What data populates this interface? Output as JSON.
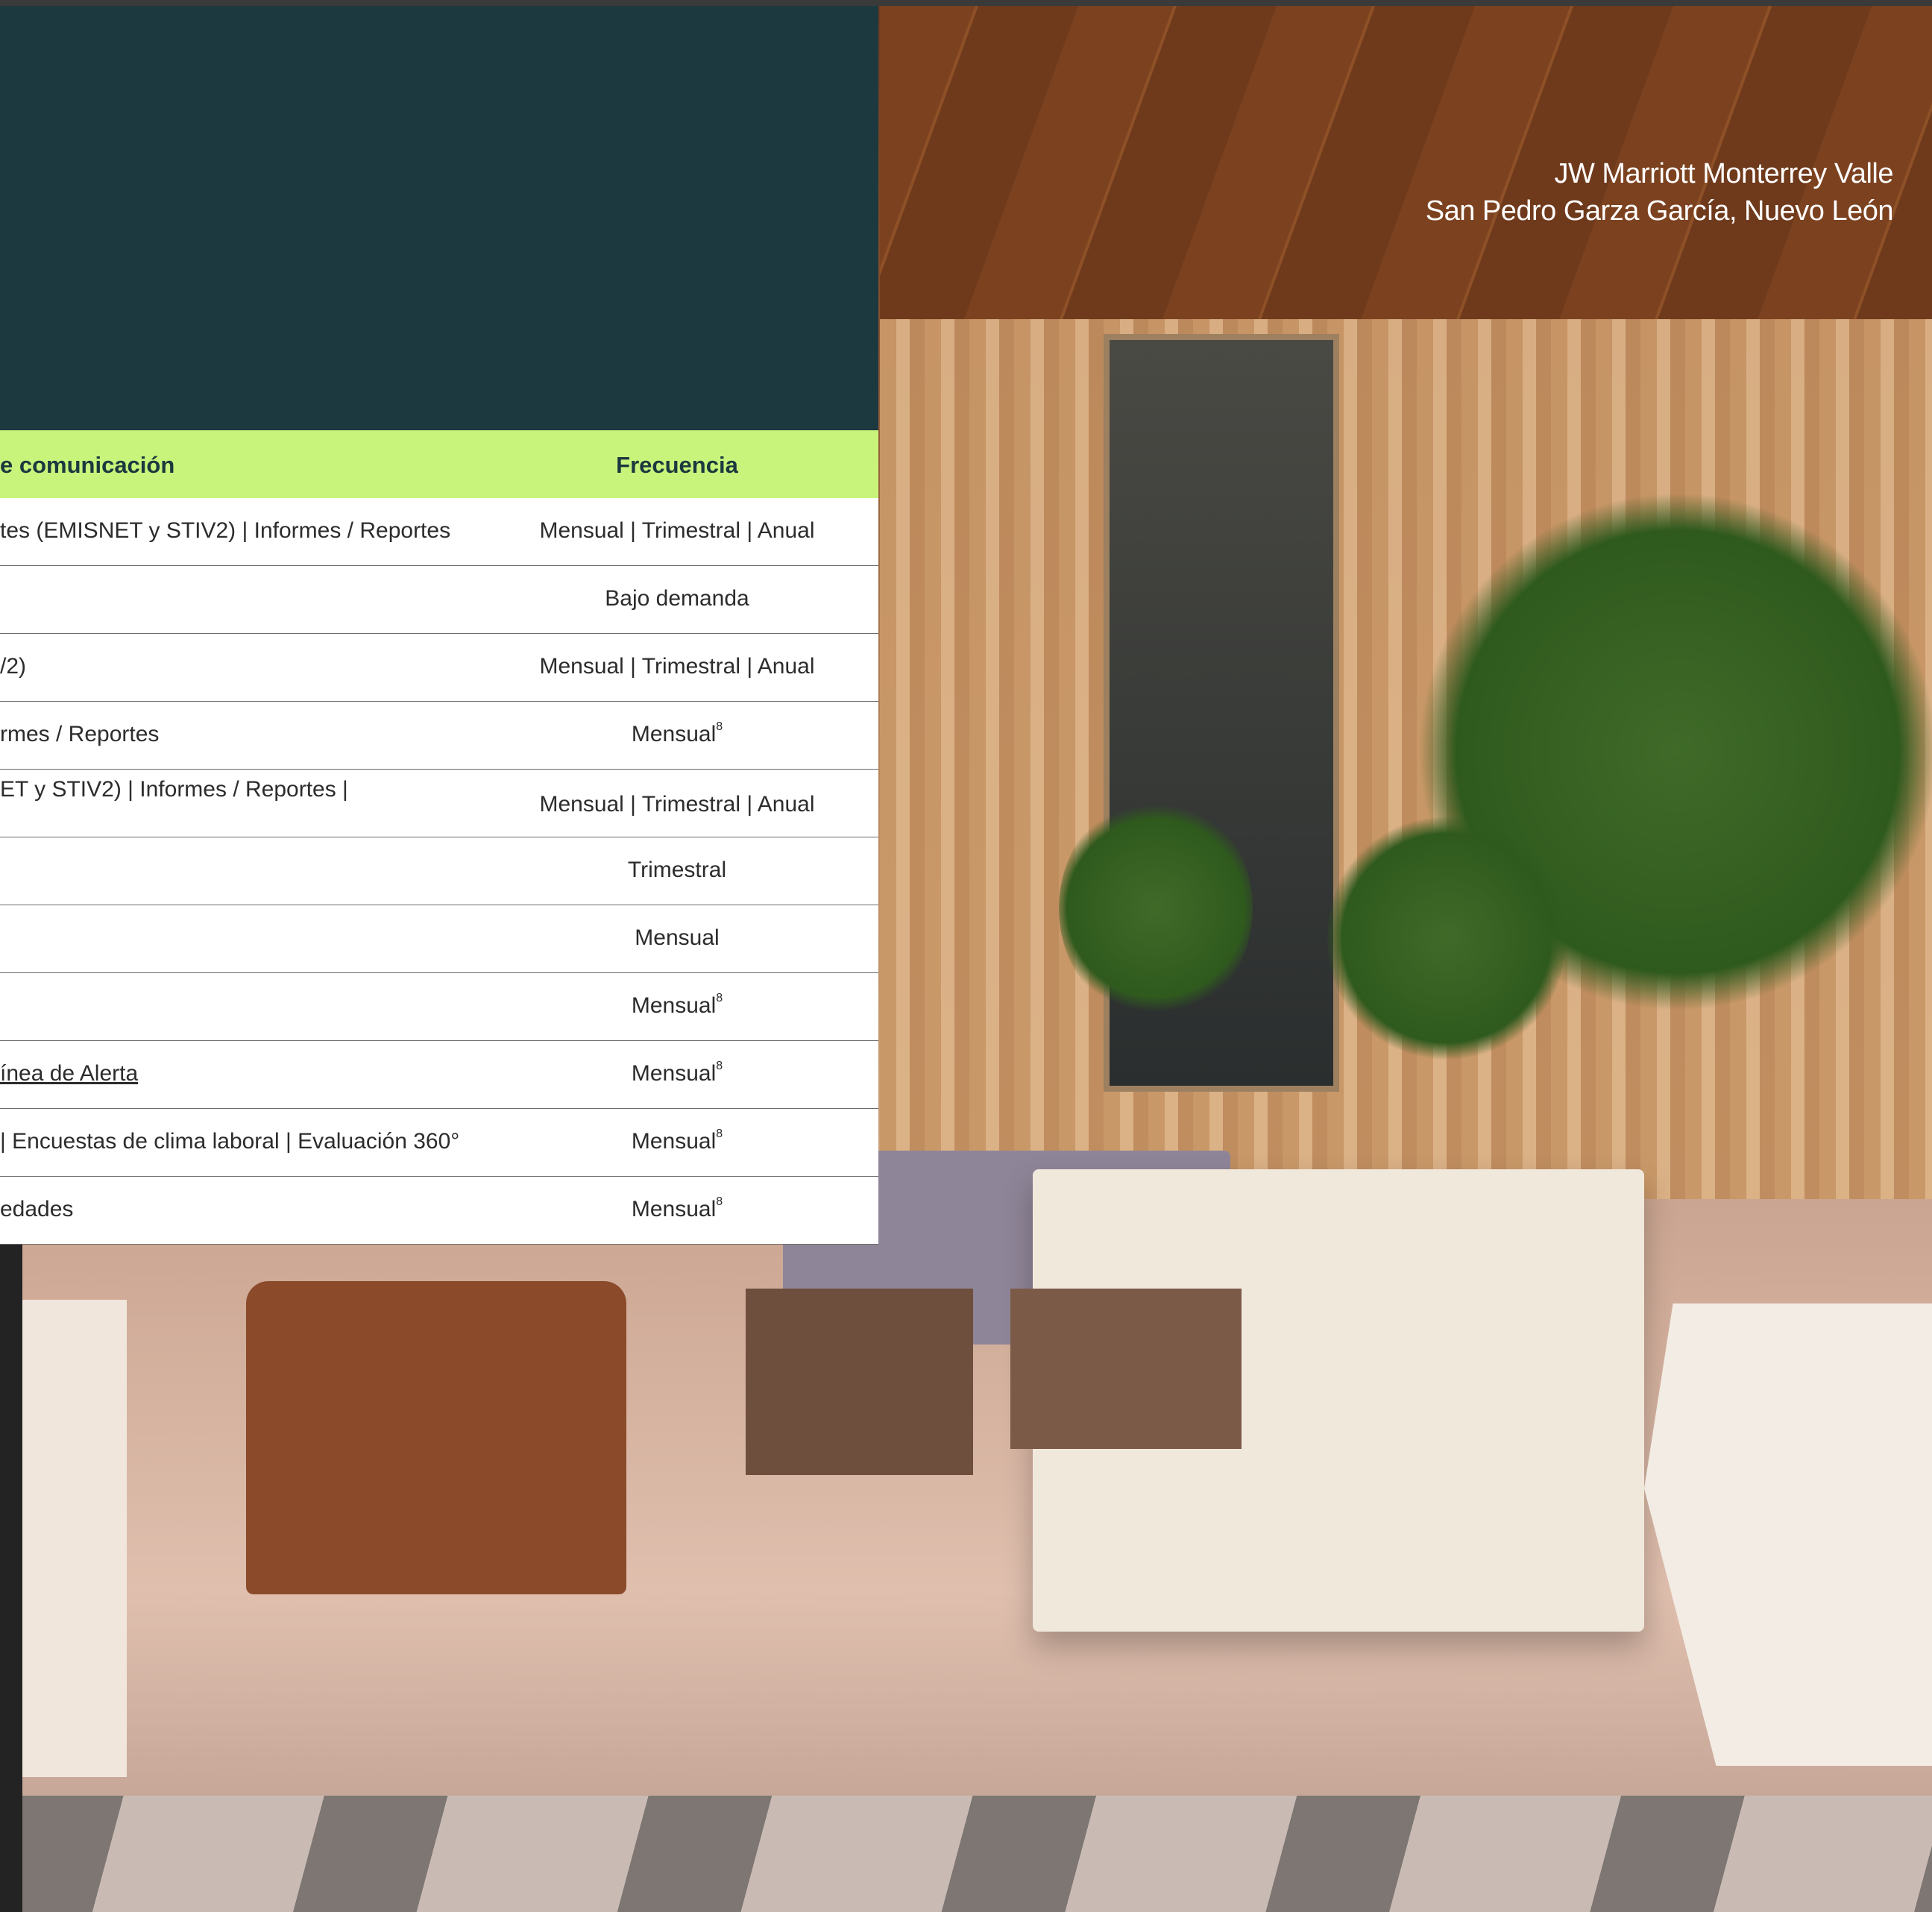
{
  "photo": {
    "caption_line1": "JW Marriott Monterrey Valle",
    "caption_line2": "San Pedro Garza García, Nuevo León"
  },
  "table": {
    "header": {
      "col1": "e comunicación",
      "col2": "Frecuencia"
    },
    "rows": [
      {
        "col1": "tes (EMISNET y STIV2) | Informes / Reportes",
        "col2": "Mensual | Trimestral | Anual",
        "sup": ""
      },
      {
        "col1": "",
        "col2": "Bajo demanda",
        "sup": ""
      },
      {
        "col1": "/2)",
        "col2": "Mensual | Trimestral | Anual",
        "sup": ""
      },
      {
        "col1": "rmes / Reportes",
        "col2": "Mensual",
        "sup": "8"
      },
      {
        "col1": "ET y STIV2) | Informes / Reportes |",
        "col2": "Mensual | Trimestral | Anual",
        "sup": ""
      },
      {
        "col1": "",
        "col2": "Trimestral",
        "sup": ""
      },
      {
        "col1": "",
        "col2": "Mensual",
        "sup": ""
      },
      {
        "col1": "",
        "col2": "Mensual",
        "sup": "8"
      },
      {
        "col1": "ínea de Alerta",
        "col2": "Mensual",
        "sup": "8"
      },
      {
        "col1": "| Encuestas de clima laboral | Evaluación 360°",
        "col2": "Mensual",
        "sup": "8"
      },
      {
        "col1": "edades",
        "col2": "Mensual",
        "sup": "8"
      }
    ]
  }
}
